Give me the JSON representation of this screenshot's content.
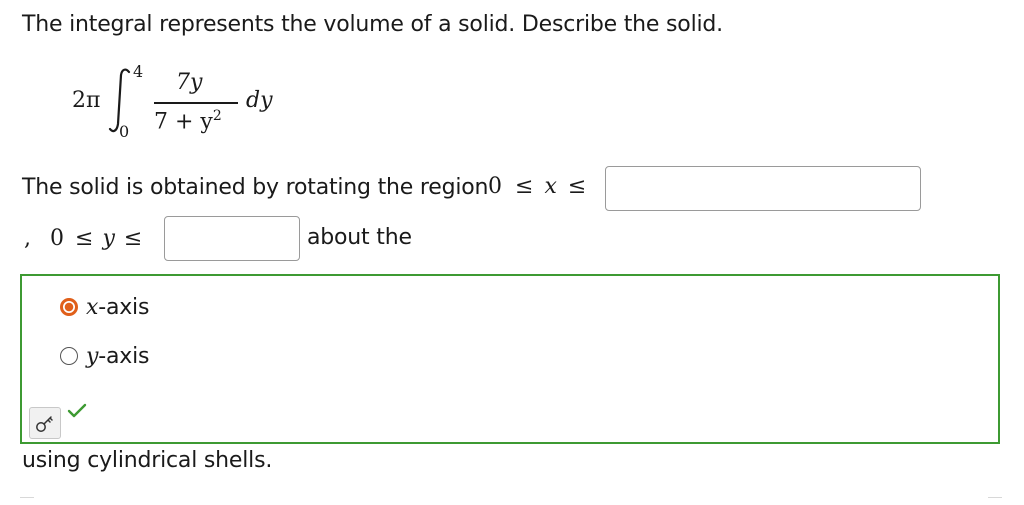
{
  "question": {
    "prompt": "The integral represents the volume of a solid. Describe the solid."
  },
  "integral": {
    "coefficient": "2π",
    "upper_limit": "4",
    "lower_limit": "0",
    "numerator": "7y",
    "denominator_base": "7 + y",
    "denominator_exp": "2",
    "differential": "dy"
  },
  "statement": {
    "part1": "The solid is obtained by rotating the region",
    "ineq_x_lower": "0",
    "ineq_x_var": "x",
    "ineq_x_op1": "≤",
    "ineq_x_op2": "≤",
    "comma": ",",
    "ineq_y_lower": "0",
    "ineq_y_var": "y",
    "ineq_y_op1": "≤",
    "ineq_y_op2": "≤",
    "part2": "about the",
    "answer_x_upper_value": "",
    "answer_y_upper_value": ""
  },
  "choices": [
    {
      "var": "x",
      "suffix": "-axis",
      "selected": true
    },
    {
      "var": "y",
      "suffix": "-axis",
      "selected": false
    }
  ],
  "feedback": {
    "key_icon": "key-icon",
    "check_icon": "checkmark-icon",
    "correct_color": "#3d9a32",
    "selected_color": "#e05f1a"
  },
  "closing": "using cylindrical shells."
}
